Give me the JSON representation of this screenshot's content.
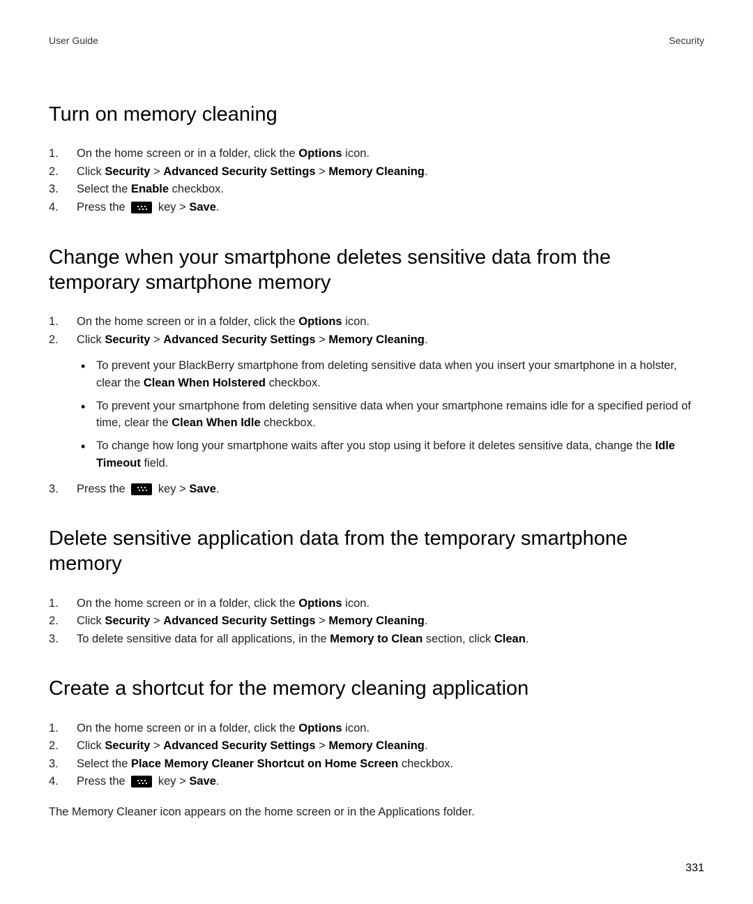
{
  "header": {
    "left": "User Guide",
    "right": "Security"
  },
  "sections": [
    {
      "heading": "Turn on memory cleaning",
      "steps": [
        {
          "num": "1.",
          "parts": [
            "On the home screen or in a folder, click the ",
            {
              "b": "Options"
            },
            " icon."
          ]
        },
        {
          "num": "2.",
          "parts": [
            "Click ",
            {
              "b": "Security"
            },
            " > ",
            {
              "b": "Advanced Security Settings"
            },
            " > ",
            {
              "b": "Memory Cleaning"
            },
            "."
          ]
        },
        {
          "num": "3.",
          "parts": [
            "Select the ",
            {
              "b": "Enable"
            },
            " checkbox."
          ]
        },
        {
          "num": "4.",
          "parts": [
            "Press the ",
            {
              "icon": "blackberry-key-icon"
            },
            " key > ",
            {
              "b": "Save"
            },
            "."
          ]
        }
      ]
    },
    {
      "heading": "Change when your smartphone deletes sensitive data from the temporary smartphone memory",
      "steps": [
        {
          "num": "1.",
          "parts": [
            "On the home screen or in a folder, click the ",
            {
              "b": "Options"
            },
            " icon."
          ]
        },
        {
          "num": "2.",
          "parts": [
            "Click ",
            {
              "b": "Security"
            },
            " > ",
            {
              "b": "Advanced Security Settings"
            },
            " > ",
            {
              "b": "Memory Cleaning"
            },
            "."
          ],
          "bullets": [
            {
              "parts": [
                "To prevent your BlackBerry smartphone from deleting sensitive data when you insert your smartphone in a holster, clear the ",
                {
                  "b": "Clean When Holstered"
                },
                " checkbox."
              ]
            },
            {
              "parts": [
                "To prevent your smartphone from deleting sensitive data when your smartphone remains idle for a specified period of time, clear the ",
                {
                  "b": "Clean When Idle"
                },
                " checkbox."
              ]
            },
            {
              "parts": [
                "To change how long your smartphone waits after you stop using it before it deletes sensitive data, change the ",
                {
                  "b": "Idle Timeout"
                },
                " field."
              ]
            }
          ]
        },
        {
          "num": "3.",
          "parts": [
            "Press the ",
            {
              "icon": "blackberry-key-icon"
            },
            " key > ",
            {
              "b": "Save"
            },
            "."
          ]
        }
      ]
    },
    {
      "heading": "Delete sensitive application data from the temporary smartphone memory",
      "steps": [
        {
          "num": "1.",
          "parts": [
            "On the home screen or in a folder, click the ",
            {
              "b": "Options"
            },
            " icon."
          ]
        },
        {
          "num": "2.",
          "parts": [
            "Click ",
            {
              "b": "Security"
            },
            " > ",
            {
              "b": "Advanced Security Settings"
            },
            " > ",
            {
              "b": "Memory Cleaning"
            },
            "."
          ]
        },
        {
          "num": "3.",
          "parts": [
            "To delete sensitive data for all applications, in the ",
            {
              "b": "Memory to Clean"
            },
            " section, click ",
            {
              "b": "Clean"
            },
            "."
          ]
        }
      ]
    },
    {
      "heading": "Create a shortcut for the memory cleaning application",
      "steps": [
        {
          "num": "1.",
          "parts": [
            "On the home screen or in a folder, click the ",
            {
              "b": "Options"
            },
            " icon."
          ]
        },
        {
          "num": "2.",
          "parts": [
            "Click ",
            {
              "b": "Security"
            },
            " > ",
            {
              "b": "Advanced Security Settings"
            },
            " > ",
            {
              "b": "Memory Cleaning"
            },
            "."
          ]
        },
        {
          "num": "3.",
          "parts": [
            "Select the ",
            {
              "b": "Place Memory Cleaner Shortcut on Home Screen"
            },
            " checkbox."
          ]
        },
        {
          "num": "4.",
          "parts": [
            "Press the ",
            {
              "icon": "blackberry-key-icon"
            },
            " key > ",
            {
              "b": "Save"
            },
            "."
          ]
        }
      ],
      "after_text": "The Memory Cleaner icon appears on the home screen or in the Applications folder."
    }
  ],
  "page_number": "331"
}
